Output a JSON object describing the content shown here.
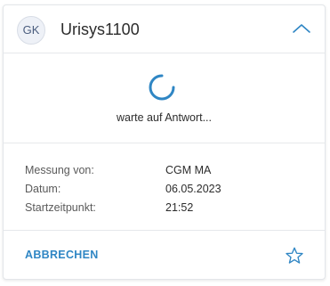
{
  "card": {
    "avatar_initials": "GK",
    "title": "Urisys1100",
    "collapse_icon": "chevron-up-icon",
    "status_text": "warte auf Antwort...",
    "spinner_icon": "loading-spinner-icon",
    "details": [
      {
        "label": "Messung von:",
        "value": "CGM MA"
      },
      {
        "label": "Datum:",
        "value": "06.05.2023"
      },
      {
        "label": "Startzeitpunkt:",
        "value": "21:52"
      }
    ],
    "cancel_label": "ABBRECHEN",
    "favorite_icon": "star-outline-icon"
  },
  "colors": {
    "accent": "#2f86c4",
    "text": "#2c2c2c",
    "muted": "#5a5a5a",
    "divider": "#e6e8eb"
  }
}
